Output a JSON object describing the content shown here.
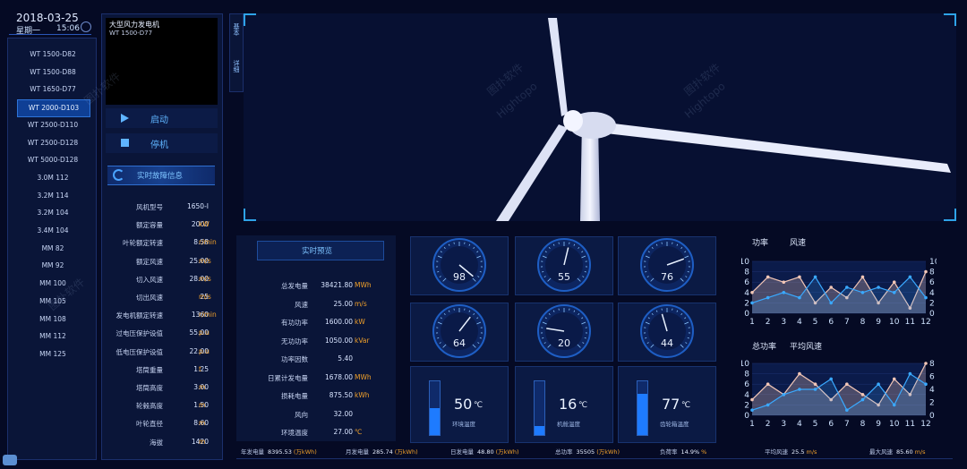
{
  "header": {
    "date": "2018-03-25",
    "weekday": "星期一",
    "time": "15:06"
  },
  "models": [
    "WT 1500-D82",
    "WT 1500-D88",
    "WT 1650-D77",
    "WT 2000-D103",
    "WT 2500-D110",
    "WT 2500-D128",
    "WT 5000-D128",
    "3.0M 112",
    "3.2M 114",
    "3.2M 104",
    "3.4M 104",
    "MM 82",
    "MM 92",
    "MM 100",
    "MM 105",
    "MM 108",
    "MM 112",
    "MM 125"
  ],
  "active_model_index": 3,
  "turbine": {
    "title": "大型风力发电机",
    "subtitle": "WT 1500-D77"
  },
  "controls": {
    "start": "启动",
    "stop": "停机",
    "fault": "实时故障信息"
  },
  "specs": [
    {
      "k": "风机型号",
      "v": "1650-I",
      "u": ""
    },
    {
      "k": "额定容量",
      "v": "2000",
      "u": "kW"
    },
    {
      "k": "叶轮额定转速",
      "v": "8.58",
      "u": "r/min"
    },
    {
      "k": "额定风速",
      "v": "25.00",
      "u": "m/s"
    },
    {
      "k": "切入风速",
      "v": "28.00",
      "u": "m/s"
    },
    {
      "k": "切出风速",
      "v": "25",
      "u": "m/s"
    },
    {
      "k": "发电机额定转速",
      "v": "1360",
      "u": "r/min"
    },
    {
      "k": "过电压保护设值",
      "v": "55.00",
      "u": "p.u"
    },
    {
      "k": "低电压保护设值",
      "v": "22.00",
      "u": "p.u"
    },
    {
      "k": "塔筒重量",
      "v": "1.25",
      "u": "t"
    },
    {
      "k": "塔筒高度",
      "v": "3.00",
      "u": "m"
    },
    {
      "k": "轮毂高度",
      "v": "1.50",
      "u": "m"
    },
    {
      "k": "叶轮直径",
      "v": "8.60",
      "u": "m"
    },
    {
      "k": "海拔",
      "v": "1420",
      "u": "m"
    }
  ],
  "side_tabs": {
    "basic": "基本",
    "detail": "详细"
  },
  "watermark": {
    "cn": "图扑软件",
    "en": "Hightopo"
  },
  "realtime": {
    "title": "实时预览",
    "rows": [
      {
        "k": "总发电量",
        "v": "38421.80",
        "u": "MWh"
      },
      {
        "k": "风速",
        "v": "25.00",
        "u": "m/s"
      },
      {
        "k": "有功功率",
        "v": "1600.00",
        "u": "kW"
      },
      {
        "k": "无功功率",
        "v": "1050.00",
        "u": "kVar"
      },
      {
        "k": "功率因数",
        "v": "5.40",
        "u": ""
      },
      {
        "k": "日累计发电量",
        "v": "1678.00",
        "u": "MWh"
      },
      {
        "k": "损耗电量",
        "v": "875.50",
        "u": "kWh"
      },
      {
        "k": "风向",
        "v": "32.00",
        "u": ""
      },
      {
        "k": "环境温度",
        "v": "27.00",
        "u": "℃"
      }
    ]
  },
  "gauges": [
    98,
    55,
    76,
    64,
    20,
    44
  ],
  "temps": [
    {
      "value": "50",
      "unit": "℃",
      "label": "环境温度",
      "level": 0.5
    },
    {
      "value": "16",
      "unit": "℃",
      "label": "机舱温度",
      "level": 0.16
    },
    {
      "value": "77",
      "unit": "℃",
      "label": "齿轮箱温度",
      "level": 0.77
    }
  ],
  "chart_data": [
    {
      "type": "line",
      "title": "",
      "x": [
        1,
        2,
        3,
        4,
        5,
        6,
        7,
        8,
        9,
        10,
        11,
        12
      ],
      "ylim": [
        0,
        10
      ],
      "y_ticks": [
        0,
        2,
        4,
        6,
        8,
        10
      ],
      "series": [
        {
          "name": "功率",
          "color": "#f2c6b6",
          "values": [
            4,
            7,
            6,
            7,
            2,
            5,
            3,
            7,
            2,
            6,
            1,
            8
          ]
        },
        {
          "name": "风速",
          "color": "#3aa9ff",
          "values": [
            2,
            3,
            4,
            3,
            7,
            2,
            5,
            4,
            5,
            4,
            7,
            3
          ]
        }
      ],
      "legend": [
        "功率",
        "风速"
      ]
    },
    {
      "type": "line",
      "title": "",
      "x": [
        1,
        2,
        3,
        4,
        5,
        6,
        7,
        8,
        9,
        10,
        11,
        12
      ],
      "ylim_left": [
        0,
        10
      ],
      "y_ticks_left": [
        0,
        2,
        4,
        6,
        8,
        10
      ],
      "ylim_right": [
        0,
        8
      ],
      "y_ticks_right": [
        0,
        2,
        4,
        6,
        8
      ],
      "series": [
        {
          "name": "总功率",
          "color": "#f2c6b6",
          "values": [
            3,
            6,
            4,
            8,
            6,
            3,
            6,
            4,
            2,
            7,
            4,
            10
          ]
        },
        {
          "name": "平均风速",
          "color": "#3aa9ff",
          "values": [
            1,
            2,
            4,
            5,
            5,
            7,
            1,
            3,
            6,
            2,
            8,
            6
          ]
        }
      ],
      "legend": [
        "总功率",
        "平均风速"
      ]
    }
  ],
  "footer": [
    {
      "k": "年发电量",
      "v": "8395.53",
      "u": "(万kWh)"
    },
    {
      "k": "月发电量",
      "v": "285.74",
      "u": "(万kWh)"
    },
    {
      "k": "日发电量",
      "v": "48.80",
      "u": "(万kWh)"
    },
    {
      "k": "总功率",
      "v": "35505",
      "u": "(万kWh)"
    },
    {
      "k": "负荷率",
      "v": "14.9%",
      "u": "%"
    },
    {
      "k": "平均风速",
      "v": "25.5",
      "u": "m/s"
    },
    {
      "k": "最大风速",
      "v": "85.60",
      "u": "m/s"
    }
  ],
  "colors": {
    "accent": "#2ea3e8",
    "orange": "#f0a02a",
    "panel": "#0a1538"
  }
}
